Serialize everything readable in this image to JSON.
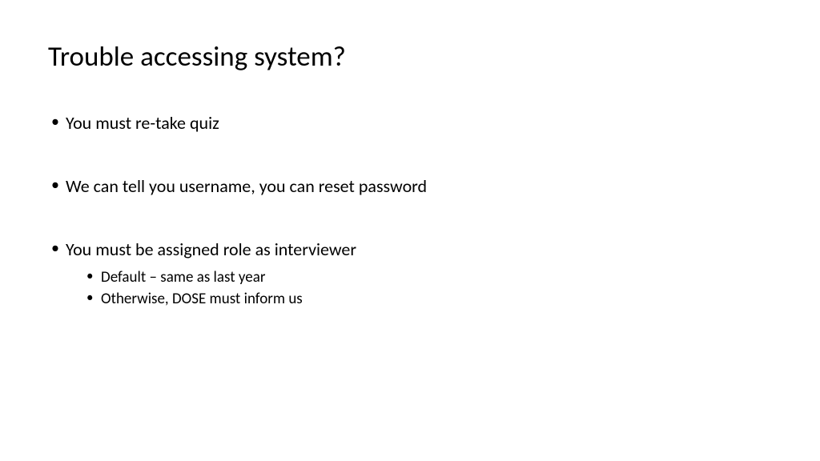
{
  "slide": {
    "title": "Trouble accessing system?",
    "bullets": [
      {
        "text": "You must re-take quiz",
        "sub": []
      },
      {
        "text": "We can tell you username, you can reset password",
        "sub": []
      },
      {
        "text": "You must be assigned role as interviewer",
        "sub": [
          "Default – same as last year",
          "Otherwise, DOSE must inform us"
        ]
      }
    ]
  }
}
